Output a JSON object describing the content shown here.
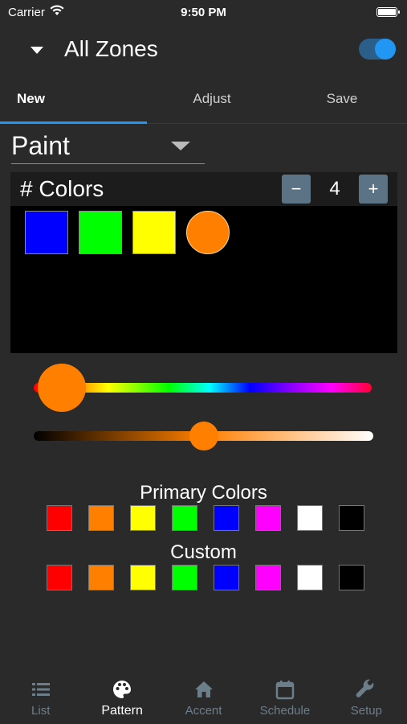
{
  "status": {
    "carrier": "Carrier",
    "time": "9:50 PM"
  },
  "header": {
    "title": "All Zones",
    "toggle_on": true
  },
  "tabs": [
    {
      "label": "New",
      "active": true
    },
    {
      "label": "Adjust",
      "active": false
    },
    {
      "label": "Save",
      "active": false
    }
  ],
  "mode": {
    "selected": "Paint"
  },
  "colors": {
    "title": "# Colors",
    "minus_label": "−",
    "plus_label": "+",
    "count": "4",
    "swatches": [
      "#0000ff",
      "#00ff00",
      "#ffff00",
      "#ff7f00"
    ]
  },
  "sliders": {
    "hue_color": "#ff7f00",
    "shade_color": "#ff7f00"
  },
  "primary": {
    "title": "Primary Colors",
    "swatches": [
      "#ff0000",
      "#ff7f00",
      "#ffff00",
      "#00ff00",
      "#0000ff",
      "#ff00ff",
      "#ffffff",
      "#000000"
    ]
  },
  "custom": {
    "title": "Custom",
    "swatches": [
      "#ff0000",
      "#ff7f00",
      "#ffff00",
      "#00ff00",
      "#0000ff",
      "#ff00ff",
      "#ffffff",
      "#000000"
    ]
  },
  "nav": [
    {
      "label": "List",
      "icon": "list-icon",
      "active": false
    },
    {
      "label": "Pattern",
      "icon": "palette-icon",
      "active": true
    },
    {
      "label": "Accent",
      "icon": "home-icon",
      "active": false
    },
    {
      "label": "Schedule",
      "icon": "calendar-icon",
      "active": false
    },
    {
      "label": "Setup",
      "icon": "wrench-icon",
      "active": false
    }
  ]
}
